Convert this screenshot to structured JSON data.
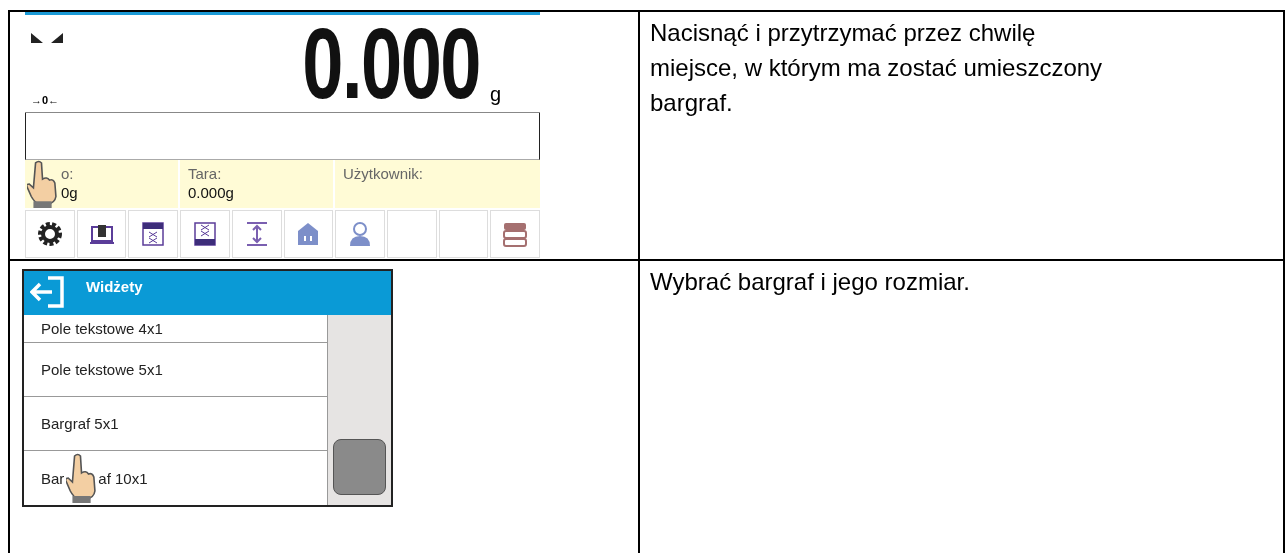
{
  "rows": [
    {
      "screen": {
        "kind": "weighing",
        "zero_mark": "→0←",
        "reading": "0.000",
        "unit": "g",
        "info": [
          {
            "label": "o:",
            "value": "0g",
            "covered": true
          },
          {
            "label": "Tara:",
            "value": "0.000g",
            "covered": false
          },
          {
            "label": "Użytkownik:",
            "covered": false
          }
        ],
        "toolbar": [
          {
            "kind": "settings"
          },
          {
            "kind": "scale"
          },
          {
            "kind": "tare-top"
          },
          {
            "kind": "tare-bottom"
          },
          {
            "kind": "range"
          },
          {
            "kind": "box"
          },
          {
            "kind": "user"
          },
          {
            "kind": "empty"
          },
          {
            "kind": "empty"
          },
          {
            "kind": "database"
          }
        ]
      },
      "instruction": "Nacisnąć i przytrzymać przez chwilę miejsce, w którym ma zostać umieszczony bargraf."
    },
    {
      "screen": {
        "kind": "widgets",
        "title": "Widżety",
        "items": [
          {
            "parts": [
              "Pole tekstowe 4x1"
            ]
          },
          {
            "parts": [
              "Pole tekstowe 5x1"
            ]
          },
          {
            "parts": [
              "Bargraf 5x1"
            ]
          },
          {
            "parts": [
              "Bar",
              "af 10x1"
            ]
          }
        ]
      },
      "instruction": "Wybrać bargraf i jego rozmiar."
    }
  ]
}
